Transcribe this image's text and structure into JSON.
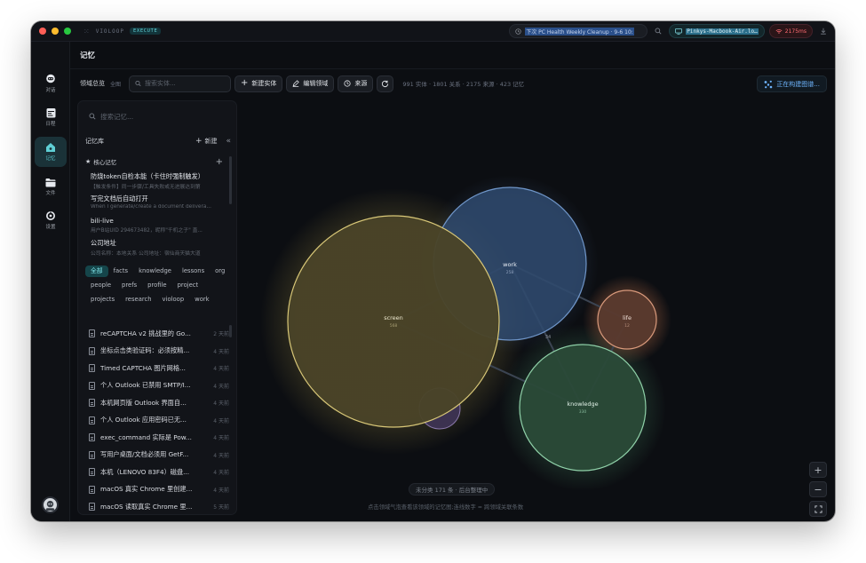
{
  "titlebar": {
    "brand": "VIOLOOP",
    "execute_badge": "EXECUTE",
    "task_text": "下次 PC Health Weekly Cleanup · 9-6 10:",
    "host_text": "Pinkys-Macbook-Air.lo…",
    "ping_text": "2175ms"
  },
  "rail": {
    "items": [
      {
        "label": "对话",
        "icon": "chat-icon"
      },
      {
        "label": "日程",
        "icon": "calendar-icon"
      },
      {
        "label": "记忆",
        "icon": "memory-icon"
      },
      {
        "label": "文件",
        "icon": "folder-icon"
      },
      {
        "label": "设置",
        "icon": "settings-icon"
      }
    ],
    "active_index": 2
  },
  "header": {
    "title": "记忆"
  },
  "toolbar": {
    "domain_overview": "领域总览",
    "scope": "全图",
    "search_placeholder": "搜索实体...",
    "new_entity": "新建实体",
    "edit_domain": "编辑领域",
    "source": "来源",
    "stats": "991 实体 · 1801 关系 · 2175 来源 · 423 记忆",
    "building": "正在构建图谱..."
  },
  "panel": {
    "search_placeholder": "搜索记忆...",
    "library_title": "记忆库",
    "new_label": "新建",
    "core_title": "核心记忆",
    "core_items": [
      {
        "title": "防烧token自检本能（卡住时强制触发）",
        "sub": "【触发条件】同一步骤/工具失败或无进展达到第"
      },
      {
        "title": "写完文档后自动打开",
        "sub": "When I generate/create a document delivera..."
      },
      {
        "title": "bili-live",
        "sub": "用户B站UID 294673482，昵称\"千机之子\" 直..."
      },
      {
        "title": "公司地址",
        "sub": "公司名称：本地关系 公司地址：宿仙商天猫大道"
      }
    ],
    "tags": [
      {
        "label": "全部",
        "active": true
      },
      {
        "label": "facts",
        "active": false
      },
      {
        "label": "knowledge",
        "active": false
      },
      {
        "label": "lessons",
        "active": false
      },
      {
        "label": "org",
        "active": false
      },
      {
        "label": "people",
        "active": false
      },
      {
        "label": "prefs",
        "active": false
      },
      {
        "label": "profile",
        "active": false
      },
      {
        "label": "project",
        "active": false
      },
      {
        "label": "projects",
        "active": false
      },
      {
        "label": "research",
        "active": false
      },
      {
        "label": "violoop",
        "active": false
      },
      {
        "label": "work",
        "active": false
      }
    ],
    "files": [
      {
        "title": "reCAPTCHA v2 挑战里的 Go...",
        "time": "2 天前"
      },
      {
        "title": "坐标点击类验证码：必须按精...",
        "time": "4 天前"
      },
      {
        "title": "Timed CAPTCHA 图片网格...",
        "time": "4 天前"
      },
      {
        "title": "个人 Outlook 已禁用 SMTP/I...",
        "time": "4 天前"
      },
      {
        "title": "本机网页版 Outlook 界面自...",
        "time": "4 天前"
      },
      {
        "title": "个人 Outlook 应用密码已无...",
        "time": "4 天前"
      },
      {
        "title": "exec_command 实际是 Pow...",
        "time": "4 天前"
      },
      {
        "title": "写用户桌面/文档必须用 GetF...",
        "time": "4 天前"
      },
      {
        "title": "本机（LENOVO 83F4）磁盘...",
        "time": "4 天前"
      },
      {
        "title": "macOS 真实 Chrome 里创建...",
        "time": "4 天前"
      },
      {
        "title": "macOS 读取真实 Chrome 里...",
        "time": "5 天前"
      }
    ]
  },
  "graph": {
    "nodes": [
      {
        "id": "work",
        "label": "work",
        "count": "258",
        "color": "#4a6d9c"
      },
      {
        "id": "screen",
        "label": "screen",
        "count": "568",
        "color": "#5f5636"
      },
      {
        "id": "life",
        "label": "life",
        "count": "12",
        "color": "#8a5c48"
      },
      {
        "id": "knowledge",
        "label": "knowledge",
        "count": "330",
        "color": "#3c6e52"
      },
      {
        "id": "misc",
        "label": "",
        "count": "",
        "color": "#6a5a80"
      }
    ],
    "edge_label": "34",
    "status": "未分类 171 条 · 后台整理中",
    "hint": "点击领域气泡查看该领域的记忆图;连线数字 = 跨领域关联条数"
  }
}
